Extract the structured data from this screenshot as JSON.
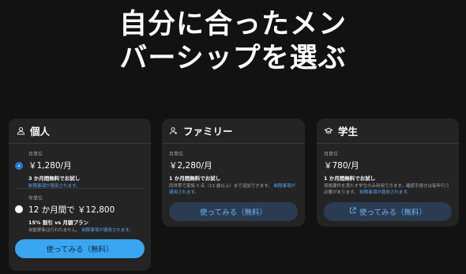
{
  "headline": {
    "line1": "自分に合ったメン",
    "line2": "バーシップを選ぶ"
  },
  "cards": {
    "individual": {
      "icon": "user-icon",
      "title": "個人",
      "plans": [
        {
          "label": "月単位",
          "price": "￥1,280/月",
          "offer": "3 か月間無料でお試し",
          "terms": "制限事項が適用されます。",
          "selected": true
        },
        {
          "label": "年単位",
          "price": "12 か月間で ￥12,800",
          "offer": "15% 割引 vs 月額プラン",
          "note": "自動更新は行われません。",
          "terms": "制限事項が適用されます。",
          "selected": false
        }
      ],
      "button": "使ってみる（無料）"
    },
    "family": {
      "icon": "family-user-icon",
      "title": "ファミリー",
      "label": "月単位",
      "price": "￥2,280/月",
      "offer": "1 か月間無料でお試し",
      "desc": "同世帯で家族 5 名（13 歳以上）まで追加できます。",
      "terms": "制限事項が適用されます。",
      "button": "使ってみる（無料）"
    },
    "student": {
      "icon": "graduation-cap-icon",
      "title": "学生",
      "label": "月単位",
      "price": "￥780/月",
      "offer": "1 か月間無料でお試し",
      "desc": "資格要件を満たす学生のみ利用できます。確認手続きは毎年行う必要があります。",
      "terms": "制限事項が適用されます。",
      "button": "使ってみる（無料）",
      "button_icon": "external-link-icon"
    }
  },
  "colors": {
    "background": "#121212",
    "card": "#242424",
    "accent": "#3aa6f2",
    "link": "#5aa9f5"
  }
}
